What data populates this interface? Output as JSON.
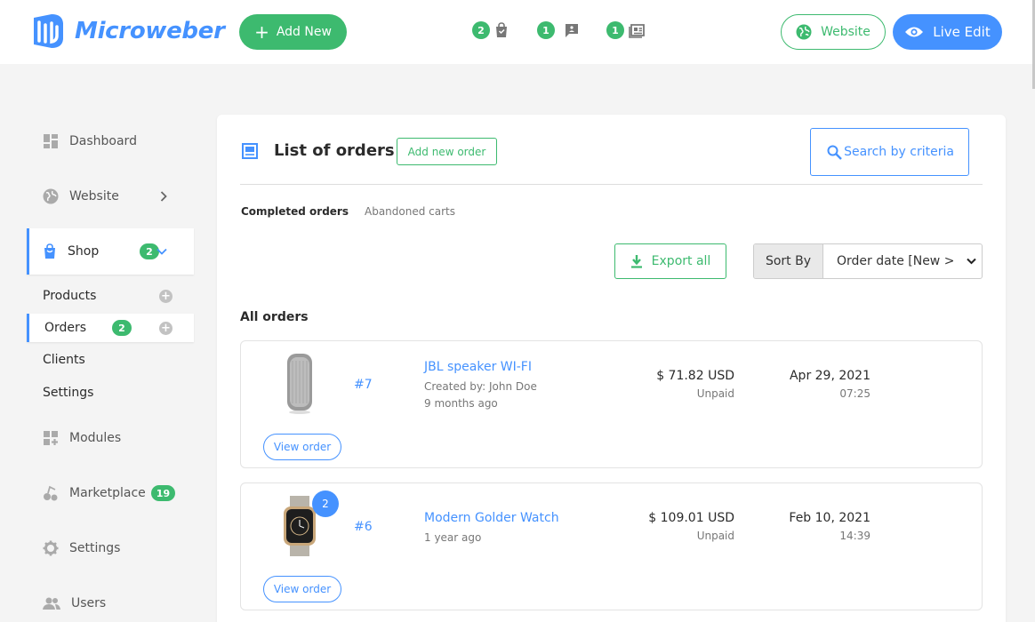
{
  "header": {
    "brand": "Microweber",
    "add_new_label": "Add New",
    "notifications": [
      {
        "count": "2",
        "icon": "shopping-bag-icon"
      },
      {
        "count": "1",
        "icon": "comment-icon"
      },
      {
        "count": "1",
        "icon": "news-icon"
      }
    ],
    "website_label": "Website",
    "live_edit_label": "Live Edit"
  },
  "sidebar": {
    "items": [
      {
        "label": "Dashboard",
        "icon": "dashboard-icon"
      },
      {
        "label": "Website",
        "icon": "globe-icon"
      },
      {
        "label": "Shop",
        "icon": "shopping-bag-icon",
        "badge": "2"
      },
      {
        "label": "Modules",
        "icon": "modules-icon"
      },
      {
        "label": "Marketplace",
        "icon": "marketplace-icon",
        "badge": "19"
      },
      {
        "label": "Settings",
        "icon": "gear-icon"
      },
      {
        "label": "Users",
        "icon": "users-icon"
      }
    ],
    "shop_sub": [
      {
        "label": "Products"
      },
      {
        "label": "Orders",
        "badge": "2"
      },
      {
        "label": "Clients"
      },
      {
        "label": "Settings"
      }
    ]
  },
  "main": {
    "title": "List of orders",
    "add_order_label": "Add new order",
    "search_label": "Search by criteria",
    "tabs": [
      {
        "label": "Completed orders",
        "active": true
      },
      {
        "label": "Abandoned carts",
        "active": false
      }
    ],
    "export_label": "Export all",
    "sort_label": "Sort By",
    "sort_value": "Order date [New >",
    "section_title": "All orders",
    "view_order_label": "View order",
    "orders": [
      {
        "number": "#7",
        "product": "JBL speaker WI-FI",
        "created_by": "Created by: John Doe",
        "ago": "9 months ago",
        "price": "$ 71.82 USD",
        "status": "Unpaid",
        "date": "Apr 29, 2021",
        "time": "07:25"
      },
      {
        "number": "#6",
        "product": "Modern Golder Watch",
        "ago": "1 year ago",
        "price": "$ 109.01 USD",
        "status": "Unpaid",
        "date": "Feb 10, 2021",
        "time": "14:39",
        "qty": "2"
      }
    ]
  },
  "colors": {
    "accent_blue": "#4592ff",
    "accent_green": "#3dba6f",
    "background": "#f4f4f4"
  }
}
